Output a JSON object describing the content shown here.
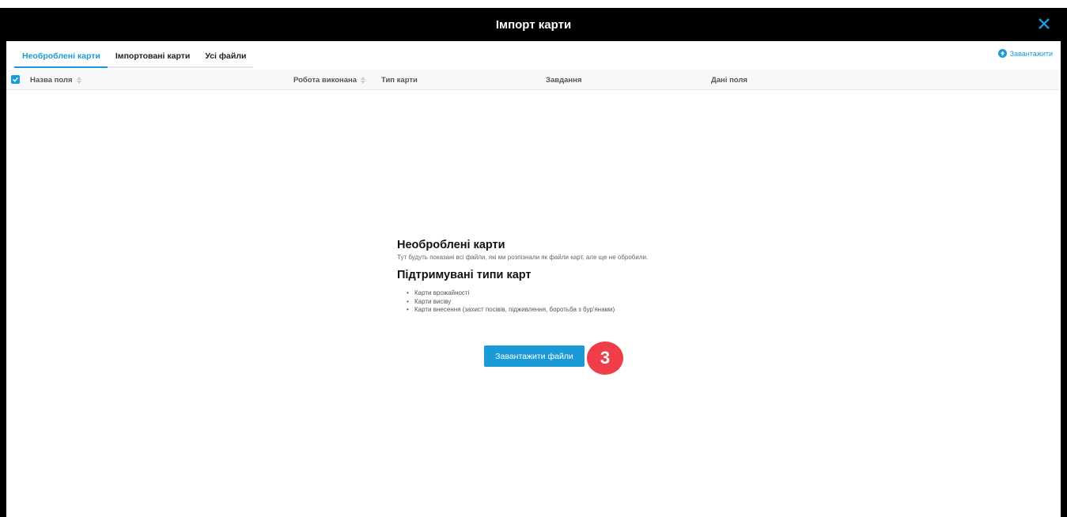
{
  "dialog": {
    "title": "Імпорт карти"
  },
  "tabs": [
    {
      "label": "Необроблені карти",
      "active": true
    },
    {
      "label": "Імпортовані карти",
      "active": false
    },
    {
      "label": "Усі файли",
      "active": false
    }
  ],
  "header_action": {
    "label": "Завантажити",
    "icon": "upload-circle-icon"
  },
  "table": {
    "columns": [
      "Назва поля",
      "Робота виконана",
      "Тип карти",
      "Завдання",
      "Дані поля"
    ],
    "select_all_checked": true
  },
  "empty_state": {
    "title": "Необроблені карти",
    "description": "Тут будуть показані всі файли, які ми розпізнали як файли карт, але ще не обробили.",
    "supported_title": "Підтримувані типи карт",
    "supported_types": [
      "Карти врожайності",
      "Карти висіву",
      "Карти внесення (захист посівів, підживлення, боротьба з бур'янами)"
    ],
    "button_label": "Завантажити файли"
  },
  "annotation": {
    "step_number": "3"
  },
  "colors": {
    "accent": "#1a9ad6",
    "title_bar": "#000000",
    "badge": "#ef3e4a"
  }
}
